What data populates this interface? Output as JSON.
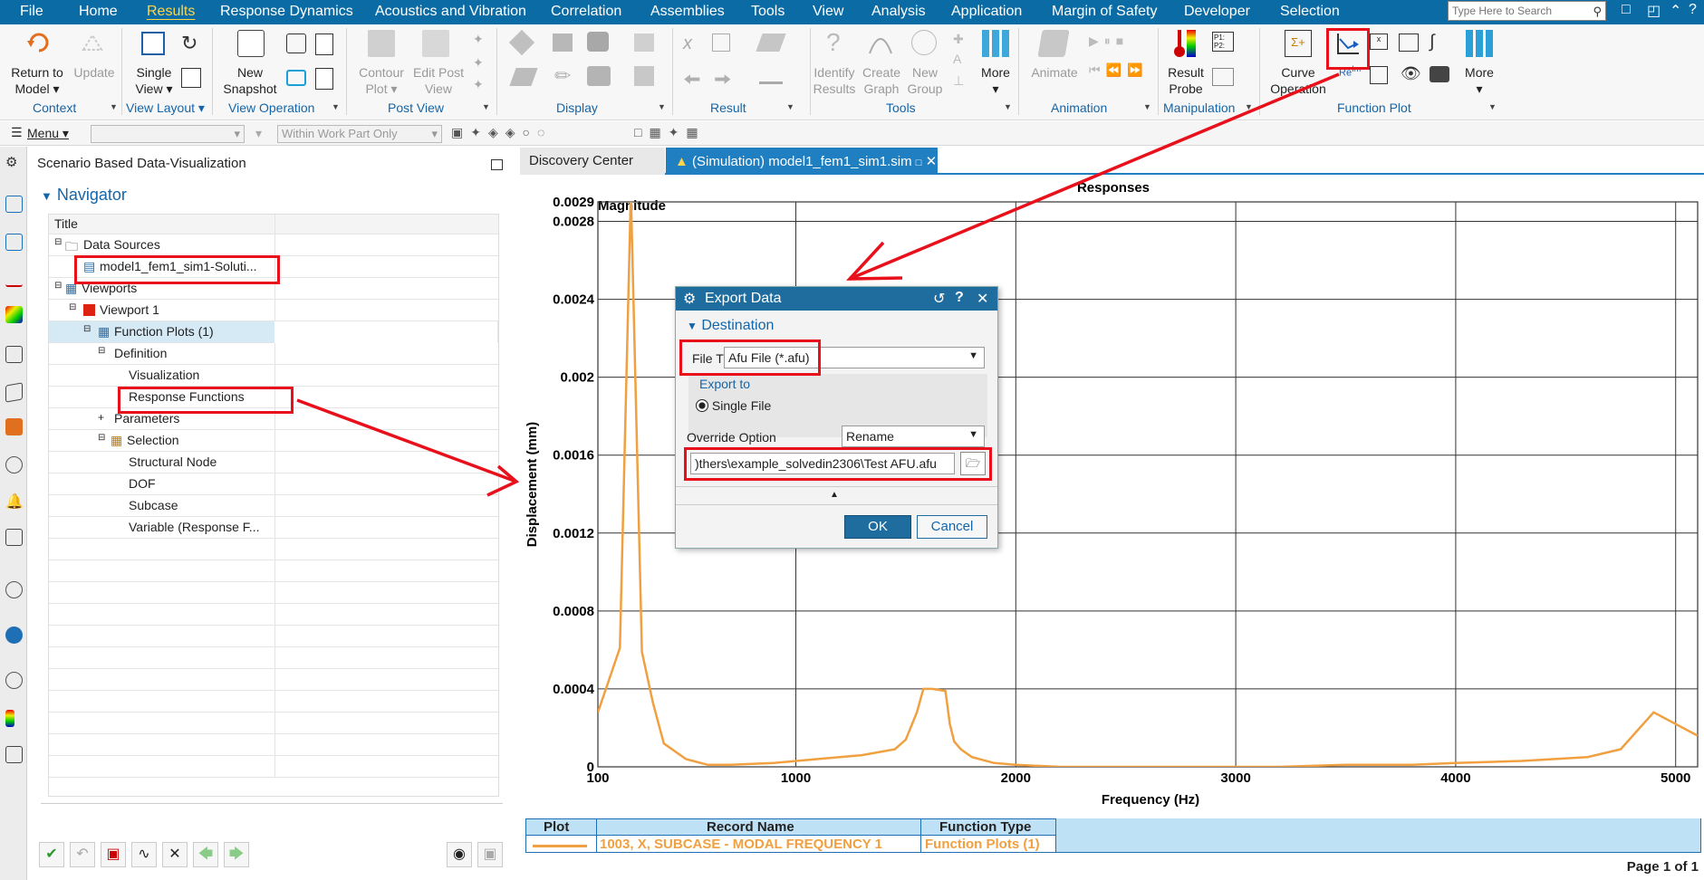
{
  "menubar": {
    "items": [
      "File",
      "Home",
      "Results",
      "Response Dynamics",
      "Acoustics and Vibration",
      "Correlation",
      "Assemblies",
      "Tools",
      "View",
      "Analysis",
      "Application",
      "Margin of Safety",
      "Developer",
      "Selection"
    ],
    "active": "Results",
    "search_placeholder": "Type Here to Search"
  },
  "ribbon": {
    "return_to_model": "Return to\nModel",
    "update": "Update",
    "single_view": "Single\nView",
    "new_snapshot": "New\nSnapshot",
    "contour_plot": "Contour\nPlot",
    "edit_post_view": "Edit Post\nView",
    "identify_results": "Identify\nResults",
    "create_graph": "Create\nGraph",
    "new_group": "New\nGroup",
    "more1": "More",
    "animate": "Animate",
    "result_probe": "Result\nProbe",
    "curve_operation": "Curve\nOperation",
    "more2": "More",
    "groups": [
      "Context",
      "View Layout",
      "View Operation",
      "Post View",
      "Display",
      "Result",
      "Tools",
      "Animation",
      "Manipulation",
      "Function Plot"
    ]
  },
  "toolbar2": {
    "menu_label": "Menu",
    "filter_placeholder": "Within Work Part Only"
  },
  "navigator": {
    "pane_title": "Scenario Based Data-Visualization",
    "header": "Navigator",
    "column_title": "Title",
    "rows": [
      {
        "label": "Data Sources"
      },
      {
        "label": "model1_fem1_sim1-Soluti..."
      },
      {
        "label": "Viewports"
      },
      {
        "label": "Viewport 1"
      },
      {
        "label": "Function Plots (1)"
      },
      {
        "label": "Definition"
      },
      {
        "label": "Visualization"
      },
      {
        "label": "Response Functions"
      },
      {
        "label": "Parameters"
      },
      {
        "label": "Selection"
      },
      {
        "label": "Structural Node"
      },
      {
        "label": "DOF"
      },
      {
        "label": "Subcase"
      },
      {
        "label": "Variable (Response F..."
      }
    ]
  },
  "tabs": {
    "discovery": "Discovery Center",
    "simulation": "(Simulation) model1_fem1_sim1.sim"
  },
  "chart_data": {
    "type": "line",
    "title": "Responses",
    "subtitle": "Magnitude",
    "xlabel": "Frequency (Hz)",
    "ylabel": "Displacement (mm)",
    "xlim": [
      100,
      5100
    ],
    "ylim": [
      0,
      0.0029
    ],
    "x_ticks": [
      100,
      1000,
      2000,
      3000,
      4000,
      5000
    ],
    "y_ticks": [
      0,
      0.0004,
      0.0008,
      0.0012,
      0.0016,
      0.002,
      0.0024,
      0.0028,
      0.0029
    ],
    "grid": true,
    "color": "#f0a040",
    "series": [
      {
        "x": [
          100,
          200,
          250,
          300,
          350,
          400,
          500,
          600,
          700,
          900,
          1100,
          1300,
          1450,
          1500,
          1550,
          1580,
          1620,
          1680,
          1700,
          1720,
          1750,
          1800,
          1900,
          2000,
          2200,
          2500,
          2800,
          3000,
          3200,
          3500,
          3800,
          4000,
          4300,
          4600,
          4750,
          4900,
          5000,
          5100
        ],
        "y": [
          0.00028,
          0.00061,
          0.00295,
          0.00059,
          0.00033,
          0.00012,
          4e-05,
          1e-05,
          1e-05,
          2e-05,
          4e-05,
          6e-05,
          9e-05,
          0.00014,
          0.00028,
          0.0004,
          0.0004,
          0.00039,
          0.00022,
          0.00013,
          9e-05,
          5e-05,
          2e-05,
          1e-05,
          0.0,
          0.0,
          0.0,
          0.0,
          0.0,
          1e-05,
          1e-05,
          2e-05,
          3e-05,
          5e-05,
          9e-05,
          0.00028,
          0.00022,
          0.00016
        ]
      }
    ]
  },
  "legend": {
    "headers": [
      "Plot",
      "Record Name",
      "Function Type"
    ],
    "record_name": "1003, X, SUBCASE - MODAL FREQUENCY 1",
    "function_type": "Function Plots (1)"
  },
  "footer": {
    "page": "Page 1 of 1"
  },
  "dialog": {
    "title": "Export Data",
    "section": "Destination",
    "file_type_label": "File T",
    "file_type_value": "Afu File (*.afu)",
    "export_to_label": "Export to",
    "single_file": "Single File",
    "override_label": "Override Option",
    "override_value": "Rename",
    "path": ")thers\\example_solvedin2306\\Test AFU.afu",
    "ok": "OK",
    "cancel": "Cancel"
  }
}
